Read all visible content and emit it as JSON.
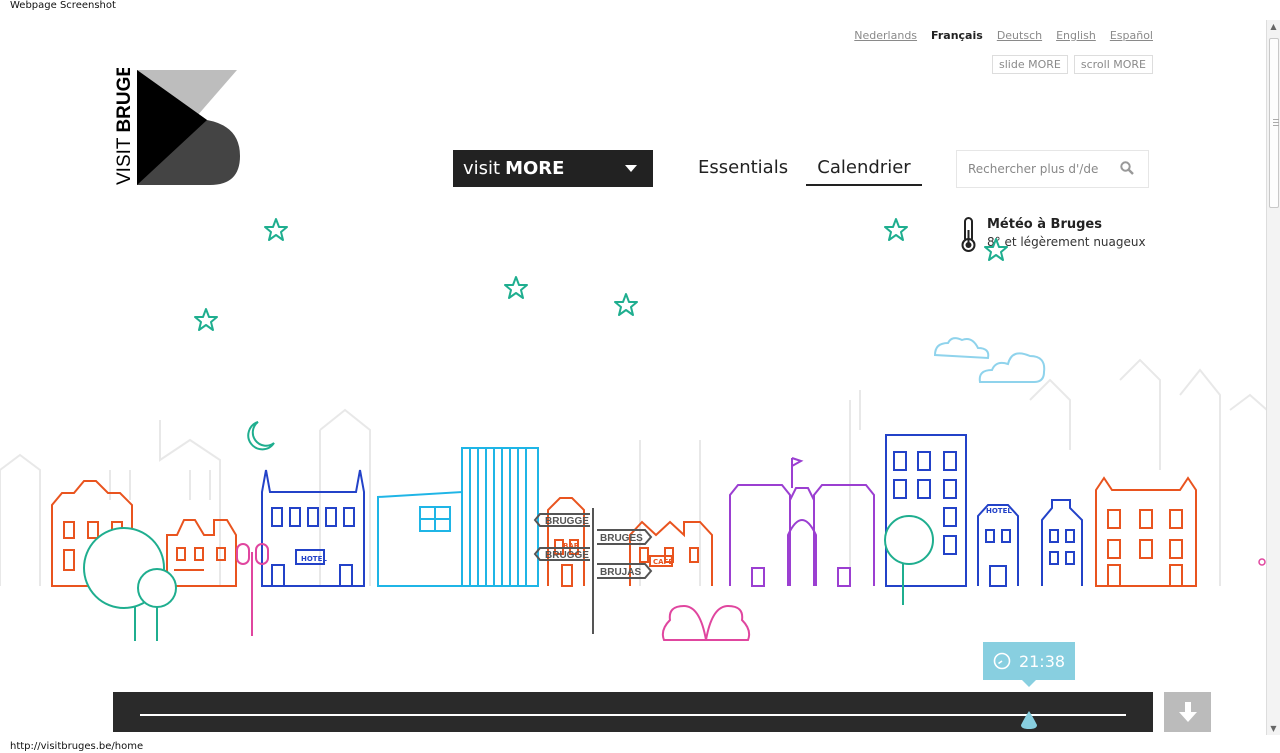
{
  "window": {
    "title": "Webpage Screenshot",
    "status_url": "http://visitbruges.be/home"
  },
  "languages": [
    {
      "label": "Nederlands",
      "active": false
    },
    {
      "label": "Français",
      "active": true
    },
    {
      "label": "Deutsch",
      "active": false
    },
    {
      "label": "English",
      "active": false
    },
    {
      "label": "Español",
      "active": false
    }
  ],
  "more_buttons": {
    "slide": "slide MORE",
    "scroll": "scroll MORE"
  },
  "logo": {
    "line1": "VISIT",
    "line2": "BRUGES"
  },
  "nav": {
    "visit_prefix": "visit",
    "visit_more": "MORE",
    "essentials": "Essentials",
    "calendar": "Calendrier"
  },
  "search": {
    "placeholder": "Rechercher plus d'/de"
  },
  "weather": {
    "title": "Météo à Bruges",
    "desc": "8° et légèrement nuageux"
  },
  "illustration": {
    "signs": [
      "BRUGGE",
      "BRUGES",
      "BRUGGE",
      "BRUJAS"
    ],
    "labels": {
      "hotel": "HOTEL",
      "bar": "BAR",
      "cafe": "CAFÉ"
    }
  },
  "time": {
    "value": "21:38"
  },
  "colors": {
    "accent": "#88cfe0",
    "star": "#1fae8f",
    "orange": "#e9541f",
    "blue": "#2342c8",
    "cyan": "#1fb5e6",
    "purple": "#9b3fd1",
    "pink": "#e0469f",
    "green": "#1fae8f",
    "dark": "#2a2a2a"
  }
}
